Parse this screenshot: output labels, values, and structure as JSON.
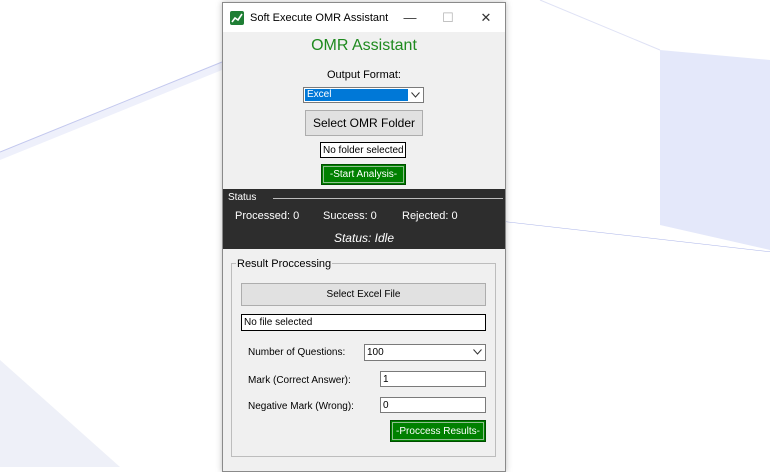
{
  "window": {
    "title": "Soft Execute OMR Assistant",
    "controls": {
      "minimize": "—",
      "maximize": "☐",
      "close": "✕"
    }
  },
  "header": {
    "title": "OMR Assistant"
  },
  "output_format": {
    "label": "Output Format:",
    "selected": "Excel"
  },
  "folder": {
    "select_label": "Select OMR Folder",
    "path_value": "No folder selected"
  },
  "start_label": "-Start Analysis-",
  "status": {
    "legend": "Status",
    "processed": "Processed: 0",
    "success": "Success: 0",
    "rejected": "Rejected: 0",
    "state": "Status: Idle"
  },
  "result": {
    "legend": "Result Proccessing",
    "select_excel_label": "Select Excel File",
    "file_value": "No file selected",
    "questions_label": "Number of Questions:",
    "questions_value": "100",
    "mark_label": "Mark (Correct Answer):",
    "mark_value": "1",
    "negative_label": "Negative Mark (Wrong):",
    "negative_value": "0",
    "process_label": "-Proccess Results-"
  },
  "colors": {
    "accent_green": "#008000",
    "title_green": "#1e8a1e",
    "status_bg": "#2d2d2d",
    "selection_blue": "#0078d7"
  }
}
